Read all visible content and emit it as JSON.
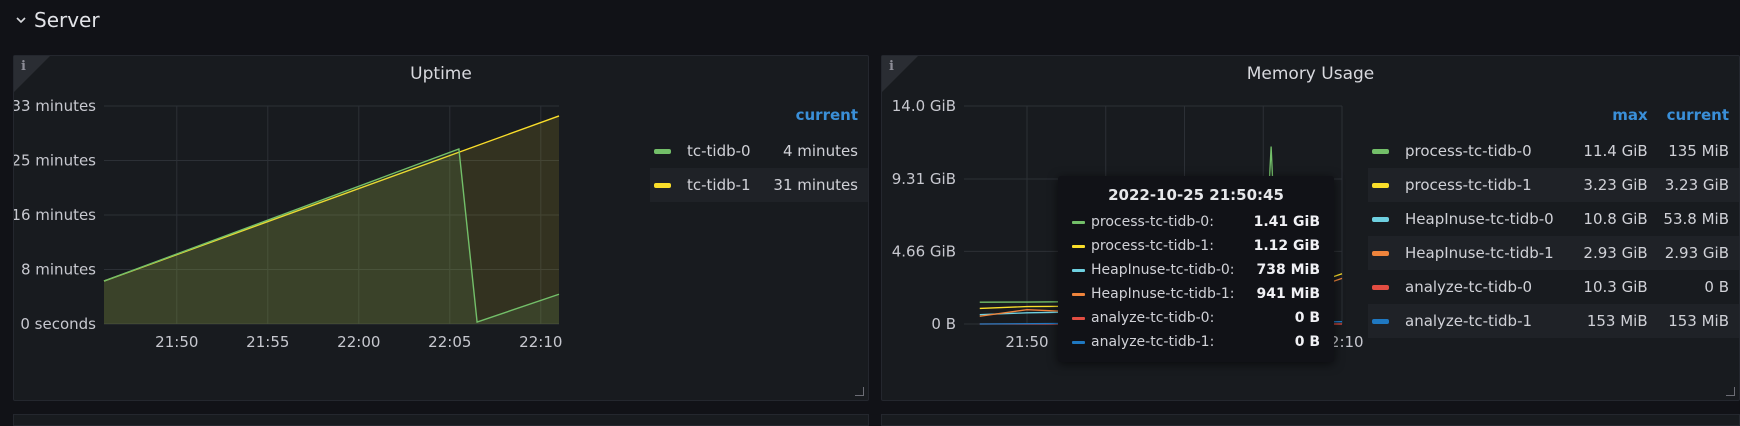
{
  "row": {
    "title": "Server"
  },
  "panels": {
    "uptime": {
      "title": "Uptime",
      "legend_header": "current",
      "legend": [
        {
          "name": "tc-tidb-0",
          "current": "4 minutes",
          "color": "#73bf69"
        },
        {
          "name": "tc-tidb-1",
          "current": "31 minutes",
          "color": "#fade2a"
        }
      ],
      "y_ticks": [
        "0 seconds",
        "8 minutes",
        "16 minutes",
        "25 minutes",
        "33 minutes"
      ],
      "x_ticks": [
        "21:50",
        "21:55",
        "22:00",
        "22:05",
        "22:10"
      ]
    },
    "memory": {
      "title": "Memory Usage",
      "legend_headers": {
        "max": "max",
        "current": "current"
      },
      "legend": [
        {
          "name": "process-tc-tidb-0",
          "max": "11.4 GiB",
          "current": "135 MiB",
          "color": "#73bf69"
        },
        {
          "name": "process-tc-tidb-1",
          "max": "3.23 GiB",
          "current": "3.23 GiB",
          "color": "#fade2a"
        },
        {
          "name": "HeapInuse-tc-tidb-0",
          "max": "10.8 GiB",
          "current": "53.8 MiB",
          "color": "#6ed0e0"
        },
        {
          "name": "HeapInuse-tc-tidb-1",
          "max": "2.93 GiB",
          "current": "2.93 GiB",
          "color": "#ef843c"
        },
        {
          "name": "analyze-tc-tidb-0",
          "max": "10.3 GiB",
          "current": "0 B",
          "color": "#e24d42"
        },
        {
          "name": "analyze-tc-tidb-1",
          "max": "153 MiB",
          "current": "153 MiB",
          "color": "#1f78c1"
        }
      ],
      "y_ticks": [
        "0 B",
        "4.66 GiB",
        "9.31 GiB",
        "14.0 GiB"
      ],
      "x_ticks": [
        "21:50",
        "21:55",
        "22:00",
        "22:05",
        "22:10"
      ],
      "tooltip": {
        "time": "2022-10-25 21:50:45",
        "rows": [
          {
            "name": "process-tc-tidb-0:",
            "value": "1.41 GiB",
            "color": "#73bf69"
          },
          {
            "name": "process-tc-tidb-1:",
            "value": "1.12 GiB",
            "color": "#fade2a"
          },
          {
            "name": "HeapInuse-tc-tidb-0:",
            "value": "738 MiB",
            "color": "#6ed0e0"
          },
          {
            "name": "HeapInuse-tc-tidb-1:",
            "value": "941 MiB",
            "color": "#ef843c"
          },
          {
            "name": "analyze-tc-tidb-0:",
            "value": "0 B",
            "color": "#e24d42"
          },
          {
            "name": "analyze-tc-tidb-1:",
            "value": "0 B",
            "color": "#1f78c1"
          }
        ]
      }
    }
  },
  "chart_data": [
    {
      "type": "area",
      "title": "Uptime",
      "xlabel": "",
      "ylabel": "",
      "x_ticks": [
        "21:50",
        "21:55",
        "22:00",
        "22:05",
        "22:10"
      ],
      "y_ticks": [
        "0 seconds",
        "8 minutes",
        "16 minutes",
        "25 minutes",
        "33 minutes"
      ],
      "ylim_minutes": [
        0,
        33
      ],
      "grid": true,
      "legend_position": "right",
      "series": [
        {
          "name": "tc-tidb-1",
          "x": [
            "21:46",
            "22:11"
          ],
          "y_minutes": [
            6.5,
            31.5
          ]
        },
        {
          "name": "tc-tidb-0",
          "x": [
            "21:46",
            "22:05:30",
            "22:06:30",
            "22:11"
          ],
          "y_minutes": [
            6.5,
            26.5,
            0.3,
            4.5
          ]
        }
      ]
    },
    {
      "type": "line",
      "title": "Memory Usage",
      "xlabel": "",
      "ylabel": "",
      "x_ticks": [
        "21:50",
        "21:55",
        "22:00",
        "22:05",
        "22:10"
      ],
      "y_ticks": [
        "0 B",
        "4.66 GiB",
        "9.31 GiB",
        "14.0 GiB"
      ],
      "ylim_gib": [
        0,
        14.0
      ],
      "grid": true,
      "legend_position": "right",
      "series": [
        {
          "name": "process-tc-tidb-0",
          "x": [
            "21:47",
            "21:50",
            "21:55",
            "22:05",
            "22:05:30",
            "22:06"
          ],
          "y_gib": [
            1.4,
            1.41,
            1.45,
            1.5,
            11.4,
            0.13
          ]
        },
        {
          "name": "process-tc-tidb-1",
          "x": [
            "21:47",
            "21:50",
            "21:55",
            "22:05",
            "22:10"
          ],
          "y_gib": [
            1.0,
            1.12,
            1.15,
            1.5,
            3.23
          ]
        },
        {
          "name": "HeapInuse-tc-tidb-0",
          "x": [
            "21:47",
            "21:50",
            "21:55",
            "22:05",
            "22:06"
          ],
          "y_gib": [
            0.6,
            0.72,
            0.8,
            1.0,
            0.05
          ]
        },
        {
          "name": "HeapInuse-tc-tidb-1",
          "x": [
            "21:47",
            "21:50",
            "21:55",
            "22:05",
            "22:10"
          ],
          "y_gib": [
            0.5,
            0.92,
            0.7,
            1.2,
            2.93
          ]
        },
        {
          "name": "analyze-tc-tidb-0",
          "x": [
            "21:47",
            "22:10"
          ],
          "y_gib": [
            0,
            0
          ]
        },
        {
          "name": "analyze-tc-tidb-1",
          "x": [
            "21:47",
            "22:10"
          ],
          "y_gib": [
            0,
            0.15
          ]
        }
      ]
    }
  ]
}
